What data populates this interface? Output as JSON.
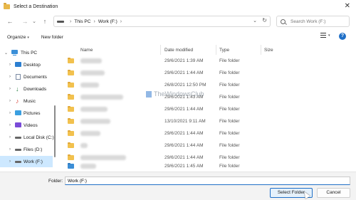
{
  "window": {
    "title": "Select a Destination",
    "close_glyph": "✕"
  },
  "nav": {
    "back_glyph": "←",
    "forward_glyph": "→",
    "dropdown_glyph": "⌄",
    "up_glyph": "↑"
  },
  "address": {
    "crumbs": [
      "This PC",
      "Work (F:)"
    ],
    "separator": "›",
    "dropdown_glyph": "⌄",
    "refresh_glyph": "↻"
  },
  "search": {
    "placeholder": "Search Work (F:)"
  },
  "toolbar": {
    "organize_label": "Organize",
    "caret": "▾",
    "new_folder_label": "New folder",
    "help_glyph": "?"
  },
  "sidebar": {
    "chevron_collapsed": "›",
    "chevron_expanded": "⌄",
    "items": [
      {
        "label": "This PC",
        "icon": "computer-icon",
        "expanded": true
      },
      {
        "label": "Desktop",
        "icon": "desktop-icon"
      },
      {
        "label": "Documents",
        "icon": "documents-icon"
      },
      {
        "label": "Downloads",
        "icon": "downloads-icon",
        "glyph": "↓"
      },
      {
        "label": "Music",
        "icon": "music-icon",
        "glyph": "♪"
      },
      {
        "label": "Pictures",
        "icon": "pictures-icon"
      },
      {
        "label": "Videos",
        "icon": "videos-icon"
      },
      {
        "label": "Local Disk (C:)",
        "icon": "drive-icon"
      },
      {
        "label": "Files (D:)",
        "icon": "drive-icon"
      },
      {
        "label": "Work (F:)",
        "icon": "drive-icon",
        "selected": true
      }
    ]
  },
  "list": {
    "columns": [
      "Name",
      "Date modified",
      "Type",
      "Size"
    ],
    "rows": [
      {
        "date": "29/6/2021 1:39 AM",
        "type": "File folder",
        "icon": "folder-icon"
      },
      {
        "date": "29/6/2021 1:44 AM",
        "type": "File folder",
        "icon": "folder-icon"
      },
      {
        "date": "26/8/2021 12:50 PM",
        "type": "File folder",
        "icon": "folder-icon"
      },
      {
        "date": "29/6/2021 1:43 AM",
        "type": "File folder",
        "icon": "folder-icon"
      },
      {
        "date": "29/6/2021 1:44 AM",
        "type": "File folder",
        "icon": "folder-icon"
      },
      {
        "date": "13/10/2021 9:11 AM",
        "type": "File folder",
        "icon": "folder-icon"
      },
      {
        "date": "29/6/2021 1:44 AM",
        "type": "File folder",
        "icon": "folder-icon"
      },
      {
        "date": "29/6/2021 1:44 AM",
        "type": "File folder",
        "icon": "folder-icon"
      },
      {
        "date": "29/6/2021 1:44 AM",
        "type": "File folder",
        "icon": "folder-icon"
      },
      {
        "date": "29/6/2021 1:45 AM",
        "type": "File folder",
        "icon": "network-folder-icon"
      }
    ]
  },
  "watermark": {
    "text": "TheWindowsClub"
  },
  "footer": {
    "folder_label": "Folder:",
    "folder_value": "Work (F:)",
    "select_label": "Select Folder",
    "cancel_label": "Cancel"
  },
  "colors": {
    "accent": "#1f6fc7",
    "selection": "#cde8ff",
    "folder": "#f2c14e"
  }
}
